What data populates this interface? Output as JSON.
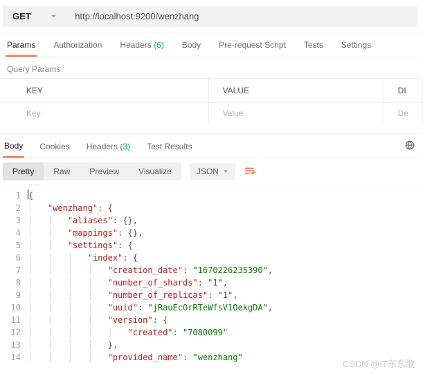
{
  "request": {
    "method": "GET",
    "url": "http://localhost:9200/wenzhang"
  },
  "req_tabs": {
    "items": [
      "Params",
      "Authorization",
      "Headers",
      "Body",
      "Pre-request Script",
      "Tests",
      "Settings"
    ],
    "active": "Params",
    "headers_count": "(6)"
  },
  "query_section": {
    "title": "Query Params",
    "col_key": "KEY",
    "col_value": "VALUE",
    "col_desc_partial": "DI",
    "ph_key": "Key",
    "ph_value": "Value",
    "ph_desc_partial": "De"
  },
  "resp_tabs": {
    "items": [
      "Body",
      "Cookies",
      "Headers",
      "Test Results"
    ],
    "active": "Body",
    "headers_count": "(3)"
  },
  "view_bar": {
    "modes": [
      "Pretty",
      "Raw",
      "Preview",
      "Visualize"
    ],
    "active": "Pretty",
    "lang": "JSON"
  },
  "code": {
    "lines": [
      {
        "n": 1,
        "indent": 0,
        "tokens": [
          {
            "t": "brace",
            "v": "{"
          }
        ],
        "cursor_before": true
      },
      {
        "n": 2,
        "indent": 1,
        "tokens": [
          {
            "t": "key",
            "v": "\"wenzhang\""
          },
          {
            "t": "punc",
            "v": ": "
          },
          {
            "t": "brace",
            "v": "{"
          }
        ]
      },
      {
        "n": 3,
        "indent": 2,
        "tokens": [
          {
            "t": "key",
            "v": "\"aliases\""
          },
          {
            "t": "punc",
            "v": ": "
          },
          {
            "t": "brace",
            "v": "{}"
          },
          {
            "t": "punc",
            "v": ","
          }
        ]
      },
      {
        "n": 4,
        "indent": 2,
        "tokens": [
          {
            "t": "key",
            "v": "\"mappings\""
          },
          {
            "t": "punc",
            "v": ": "
          },
          {
            "t": "brace",
            "v": "{}"
          },
          {
            "t": "punc",
            "v": ","
          }
        ]
      },
      {
        "n": 5,
        "indent": 2,
        "tokens": [
          {
            "t": "key",
            "v": "\"settings\""
          },
          {
            "t": "punc",
            "v": ": "
          },
          {
            "t": "brace",
            "v": "{"
          }
        ]
      },
      {
        "n": 6,
        "indent": 3,
        "tokens": [
          {
            "t": "key",
            "v": "\"index\""
          },
          {
            "t": "punc",
            "v": ": "
          },
          {
            "t": "brace",
            "v": "{"
          }
        ]
      },
      {
        "n": 7,
        "indent": 4,
        "tokens": [
          {
            "t": "key",
            "v": "\"creation_date\""
          },
          {
            "t": "punc",
            "v": ": "
          },
          {
            "t": "str",
            "v": "\"1670226235390\""
          },
          {
            "t": "punc",
            "v": ","
          }
        ]
      },
      {
        "n": 8,
        "indent": 4,
        "tokens": [
          {
            "t": "key",
            "v": "\"number_of_shards\""
          },
          {
            "t": "punc",
            "v": ": "
          },
          {
            "t": "str",
            "v": "\"1\""
          },
          {
            "t": "punc",
            "v": ","
          }
        ]
      },
      {
        "n": 9,
        "indent": 4,
        "tokens": [
          {
            "t": "key",
            "v": "\"number_of_replicas\""
          },
          {
            "t": "punc",
            "v": ": "
          },
          {
            "t": "str",
            "v": "\"1\""
          },
          {
            "t": "punc",
            "v": ","
          }
        ]
      },
      {
        "n": 10,
        "indent": 4,
        "tokens": [
          {
            "t": "key",
            "v": "\"uuid\""
          },
          {
            "t": "punc",
            "v": ": "
          },
          {
            "t": "str",
            "v": "\"jRauEcOrRTeWfsV1OekgDA\""
          },
          {
            "t": "punc",
            "v": ","
          }
        ]
      },
      {
        "n": 11,
        "indent": 4,
        "tokens": [
          {
            "t": "key",
            "v": "\"version\""
          },
          {
            "t": "punc",
            "v": ": "
          },
          {
            "t": "brace",
            "v": "{"
          }
        ]
      },
      {
        "n": 12,
        "indent": 5,
        "tokens": [
          {
            "t": "key",
            "v": "\"created\""
          },
          {
            "t": "punc",
            "v": ": "
          },
          {
            "t": "str",
            "v": "\"7080099\""
          }
        ]
      },
      {
        "n": 13,
        "indent": 4,
        "tokens": [
          {
            "t": "brace",
            "v": "}"
          },
          {
            "t": "punc",
            "v": ","
          }
        ]
      },
      {
        "n": 14,
        "indent": 4,
        "tokens": [
          {
            "t": "key",
            "v": "\"provided_name\""
          },
          {
            "t": "punc",
            "v": ": "
          },
          {
            "t": "str",
            "v": "\"wenzhang\""
          }
        ]
      }
    ]
  },
  "watermark": "CSDN @IT东东歌"
}
